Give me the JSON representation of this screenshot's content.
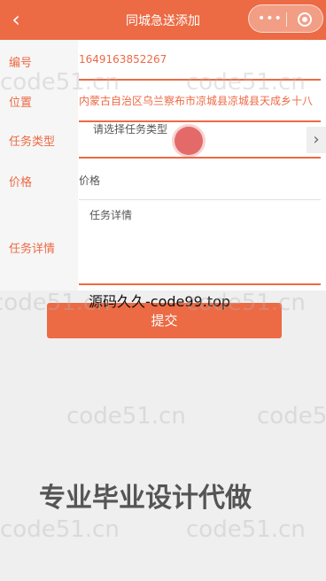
{
  "header": {
    "back_icon": "‹",
    "title": "同城急送添加",
    "menu_icon": "•••"
  },
  "form": {
    "id_label": "编号",
    "id_value": "1649163852267",
    "location_label": "位置",
    "location_value": "内蒙古自治区乌兰察布市凉城县凉城县天成乡十八",
    "task_type_label": "任务类型",
    "task_type_placeholder": "请选择任务类型",
    "price_label": "价格",
    "price_placeholder": "价格",
    "detail_label": "任务详情",
    "detail_placeholder": "任务详情",
    "chevron": "›"
  },
  "submit_label": "提交",
  "overlay_text": "源码久久-code99.top",
  "watermarks": [
    "code51.cn",
    "code51.cn",
    "code51.cn",
    "code51.cn",
    "code51.cn",
    "code51.cn",
    "code51.cn",
    "code51.cn"
  ],
  "banner": "专业毕业设计代做"
}
